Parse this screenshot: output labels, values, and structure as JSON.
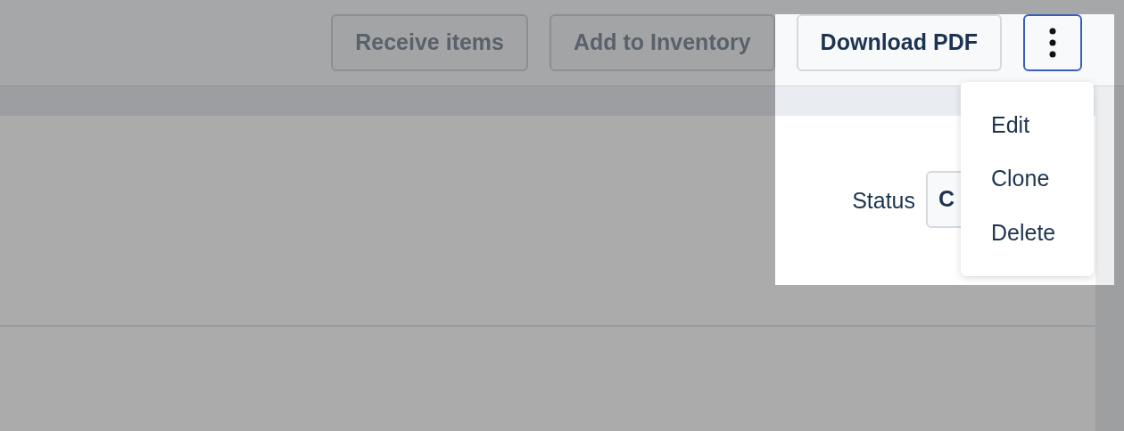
{
  "toolbar": {
    "buttons": [
      {
        "label": "Receive items",
        "disabled": true
      },
      {
        "label": "Add to Inventory",
        "disabled": true
      },
      {
        "label": "Download PDF",
        "disabled": false
      }
    ],
    "more_menu": {
      "expanded": true,
      "items": [
        "Edit",
        "Clone",
        "Delete"
      ]
    }
  },
  "status": {
    "label": "Status",
    "value": "C"
  }
}
